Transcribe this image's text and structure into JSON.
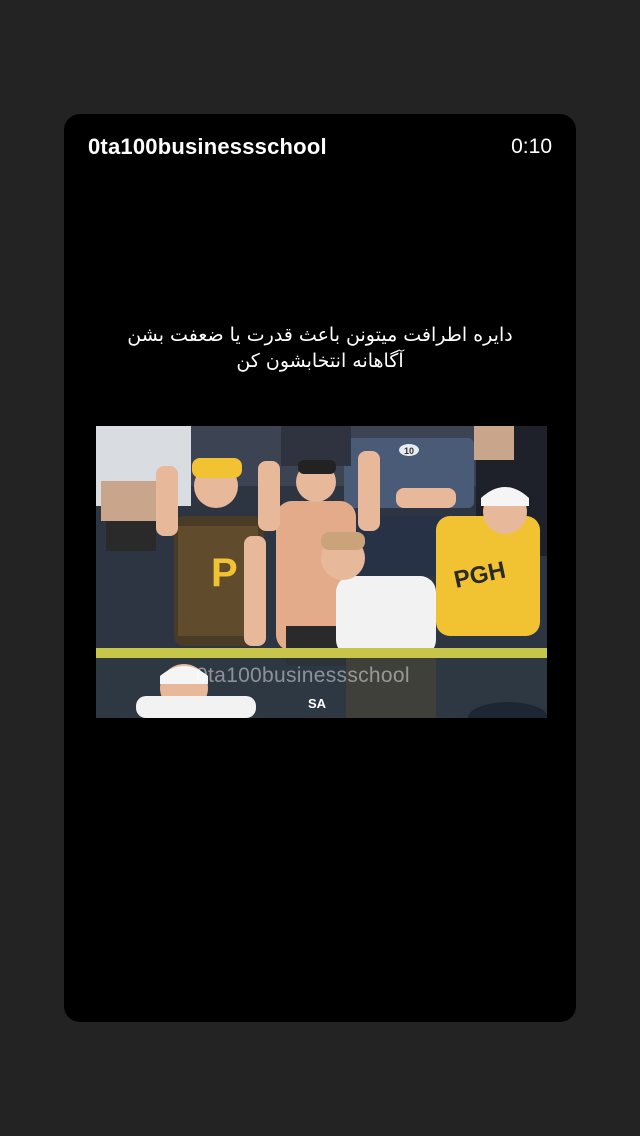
{
  "story": {
    "username": "0ta100businessschool",
    "elapsed": "0:10"
  },
  "caption": {
    "line1": "دایره اطرافت میتونن باعث قدرت یا ضعفت بشن",
    "line2": "آگاهانه انتخابشون کن"
  },
  "media": {
    "watermark": "0ta100businessschool",
    "broadcast_logo": "SA",
    "seat_number": "10",
    "shirt_letter": "P",
    "shirt_text": "PGH"
  }
}
